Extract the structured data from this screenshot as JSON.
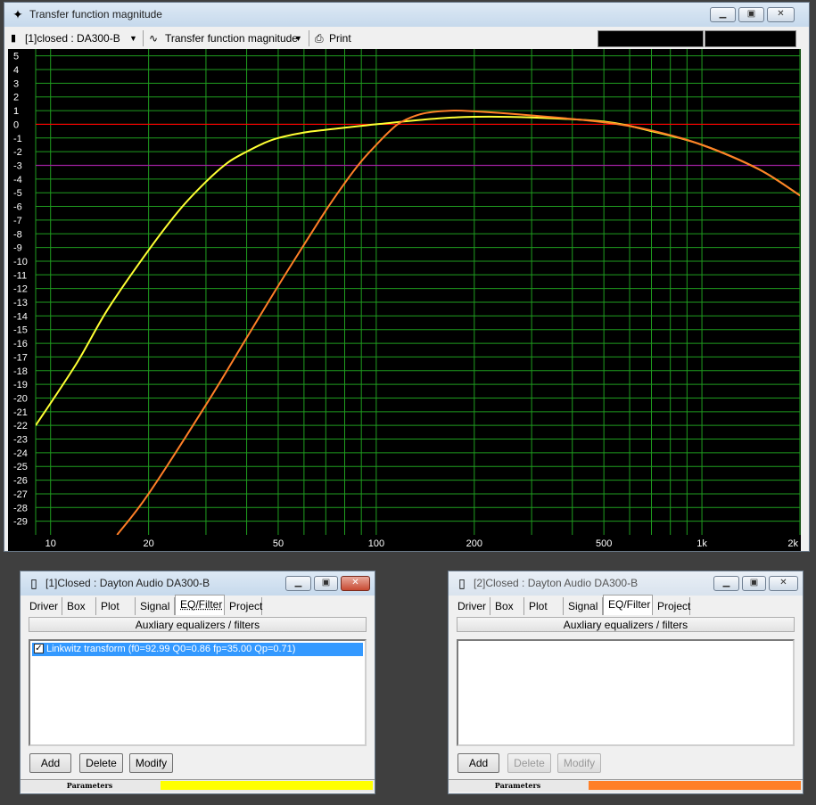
{
  "main_window": {
    "title": "Transfer function magnitude",
    "toolbar": {
      "project_selector": "[1]closed : DA300-B",
      "plot_selector": "Transfer function magnitude",
      "print_label": "Print"
    }
  },
  "chart_data": {
    "type": "line",
    "x_scale": "log",
    "xlim": [
      9,
      2000
    ],
    "ylim": [
      -30,
      5.5
    ],
    "x_tick_labels": [
      {
        "v": 10,
        "label": "10"
      },
      {
        "v": 20,
        "label": "20"
      },
      {
        "v": 50,
        "label": "50"
      },
      {
        "v": 100,
        "label": "100"
      },
      {
        "v": 200,
        "label": "200"
      },
      {
        "v": 500,
        "label": "500"
      },
      {
        "v": 1000,
        "label": "1k"
      },
      {
        "v": 2000,
        "label": "2k"
      }
    ],
    "y_tick_labels": [
      "5",
      "4",
      "3",
      "2",
      "1",
      "0",
      "-1",
      "-2",
      "-3",
      "-4",
      "-5",
      "-6",
      "-7",
      "-8",
      "-9",
      "-10",
      "-11",
      "-12",
      "-13",
      "-14",
      "-15",
      "-16",
      "-17",
      "-18",
      "-19",
      "-20",
      "-21",
      "-22",
      "-23",
      "-24",
      "-25",
      "-26",
      "-27",
      "-28",
      "-29"
    ],
    "y_ticks": [
      5,
      4,
      3,
      2,
      1,
      0,
      -1,
      -2,
      -3,
      -4,
      -5,
      -6,
      -7,
      -8,
      -9,
      -10,
      -11,
      -12,
      -13,
      -14,
      -15,
      -16,
      -17,
      -18,
      -19,
      -20,
      -21,
      -22,
      -23,
      -24,
      -25,
      -26,
      -27,
      -28,
      -29
    ],
    "grid": true,
    "reference_lines": [
      {
        "y": 0,
        "color": "#ff0000"
      },
      {
        "y": -3,
        "color": "#a020a0"
      }
    ],
    "series": [
      {
        "color": "#ffff33",
        "points": [
          [
            9,
            -22
          ],
          [
            12,
            -17.5
          ],
          [
            15,
            -13.5
          ],
          [
            20,
            -9.2
          ],
          [
            25,
            -6.2
          ],
          [
            30,
            -4.2
          ],
          [
            35,
            -2.8
          ],
          [
            40,
            -2.0
          ],
          [
            45,
            -1.4
          ],
          [
            50,
            -1.0
          ],
          [
            60,
            -0.6
          ],
          [
            70,
            -0.4
          ],
          [
            80,
            -0.25
          ],
          [
            100,
            0.0
          ],
          [
            150,
            0.4
          ],
          [
            200,
            0.55
          ],
          [
            300,
            0.5
          ],
          [
            500,
            0.2
          ],
          [
            700,
            -0.5
          ],
          [
            1000,
            -1.5
          ],
          [
            1500,
            -3.3
          ],
          [
            2000,
            -5.2
          ]
        ]
      },
      {
        "color": "#ff7f27",
        "points": [
          [
            16,
            -30
          ],
          [
            20,
            -27
          ],
          [
            30,
            -20.5
          ],
          [
            40,
            -15.6
          ],
          [
            50,
            -11.8
          ],
          [
            60,
            -8.8
          ],
          [
            70,
            -6.3
          ],
          [
            80,
            -4.3
          ],
          [
            90,
            -2.7
          ],
          [
            100,
            -1.5
          ],
          [
            110,
            -0.5
          ],
          [
            120,
            0.2
          ],
          [
            140,
            0.8
          ],
          [
            170,
            1.0
          ],
          [
            200,
            0.95
          ],
          [
            300,
            0.65
          ],
          [
            500,
            0.15
          ],
          [
            700,
            -0.45
          ],
          [
            1000,
            -1.5
          ],
          [
            1500,
            -3.3
          ],
          [
            2000,
            -5.2
          ]
        ]
      }
    ]
  },
  "panel1": {
    "title": "[1]Closed : Dayton Audio DA300-B",
    "tabs": [
      "Driver",
      "Box",
      "Plot",
      "Signal",
      "EQ/Filter",
      "Project"
    ],
    "section_label": "Auxliary equalizers / filters",
    "items": [
      "Linkwitz transform (f0=92.99 Q0=0.86 fp=35.00 Qp=0.71)"
    ],
    "buttons": {
      "add": "Add",
      "delete": "Delete",
      "modify": "Modify"
    },
    "status_label": "Parameters",
    "status_color": "#ffff00"
  },
  "panel2": {
    "title": "[2]Closed : Dayton Audio DA300-B",
    "tabs": [
      "Driver",
      "Box",
      "Plot",
      "Signal",
      "EQ/Filter",
      "Project"
    ],
    "section_label": "Auxliary equalizers / filters",
    "buttons": {
      "add": "Add",
      "delete": "Delete",
      "modify": "Modify"
    },
    "status_label": "Parameters",
    "status_color": "#ff7f27"
  }
}
